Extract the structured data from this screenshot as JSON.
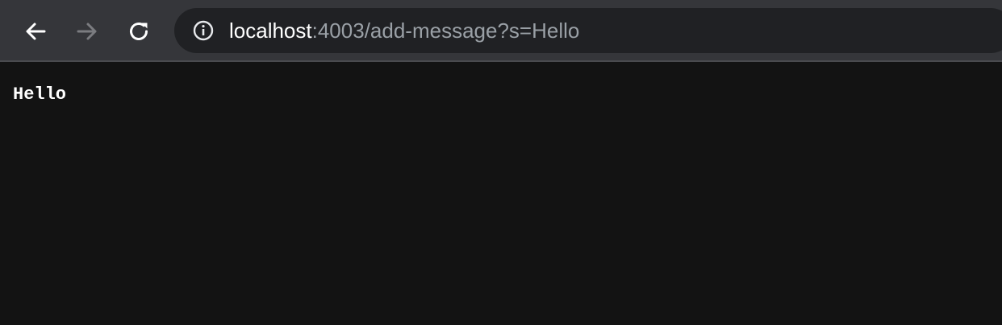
{
  "browser": {
    "url_host": "localhost",
    "url_rest": ":4003/add-message?s=Hello",
    "icons": {
      "back": "arrow-left-icon",
      "forward": "arrow-right-icon",
      "reload": "reload-icon",
      "site_info": "info-icon"
    },
    "colors": {
      "toolbar": "#35363a",
      "omnibox": "#202124",
      "url_host": "#ffffff",
      "url_rest": "#9aa0a6",
      "forward_disabled": "#7b7c80"
    }
  },
  "page": {
    "message": "Hello",
    "background": "#131313"
  }
}
